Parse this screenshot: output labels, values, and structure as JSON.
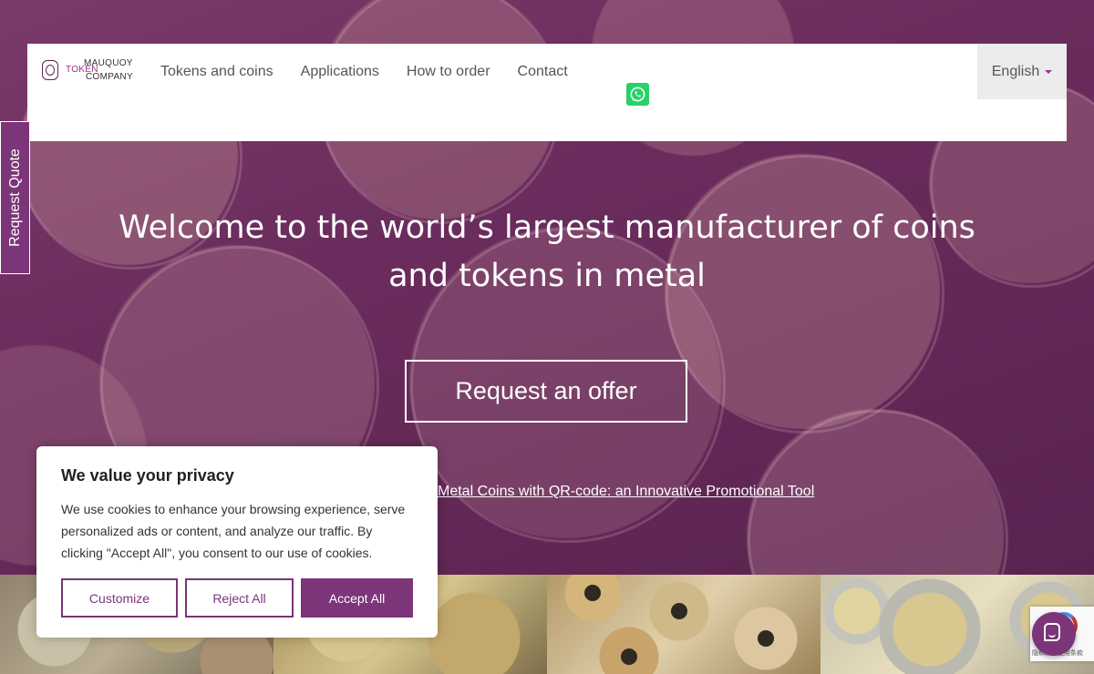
{
  "logo": {
    "top": "MAUQUOY",
    "mid": "TOKEN",
    "bottom": "COMPANY"
  },
  "nav": {
    "links": [
      "Tokens and coins",
      "Applications",
      "How to order",
      "Contact"
    ],
    "language": "English"
  },
  "side_tab": {
    "label": "Request Quote"
  },
  "hero": {
    "headline": "Welcome to the world’s largest manufacturer of coins and tokens in metal",
    "cta": "Request an offer",
    "promo_link": "Metal Coins with QR-code: an Innovative Promotional Tool"
  },
  "cookie": {
    "title": "We value your privacy",
    "text": "We use cookies to enhance your browsing experience, serve personalized ads or content, and analyze our traffic. By clicking \"Accept All\", you consent to our use of cookies.",
    "customize": "Customize",
    "reject": "Reject All",
    "accept": "Accept All"
  },
  "recaptcha": {
    "text": "隐私权 - 使用条款"
  },
  "colors": {
    "brand_purple": "#7b3578",
    "whatsapp_green": "#25d366"
  },
  "icons": [
    "whatsapp-icon",
    "caret-down-icon",
    "chat-icon",
    "recaptcha-icon"
  ]
}
